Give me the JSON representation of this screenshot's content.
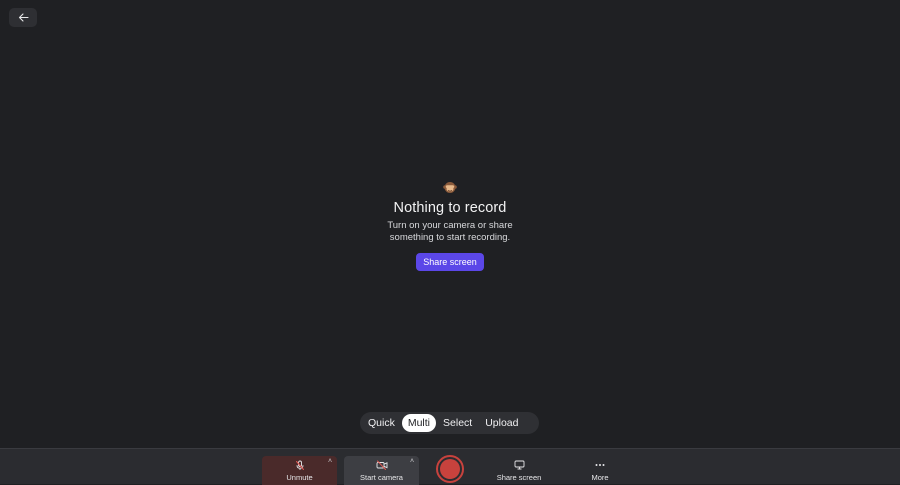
{
  "nav": {
    "back_icon": "arrow-left-icon"
  },
  "empty_state": {
    "emoji": "monkey-see-no-evil-icon",
    "title": "Nothing to record",
    "description": "Turn on your camera or share something to start recording.",
    "button_label": "Share screen"
  },
  "modes": {
    "items": [
      {
        "label": "Quick",
        "active": false
      },
      {
        "label": "Multi",
        "active": true
      },
      {
        "label": "Select",
        "active": false
      },
      {
        "label": "Upload",
        "active": false
      }
    ]
  },
  "toolbar": {
    "unmute_label": "Unmute",
    "camera_label": "Start camera",
    "share_label": "Share screen",
    "more_label": "More",
    "caret": "˄"
  },
  "colors": {
    "background": "#1f2023",
    "accent": "#5b47e8",
    "record": "#c8423d",
    "muted_bg": "#4a2a2a"
  }
}
